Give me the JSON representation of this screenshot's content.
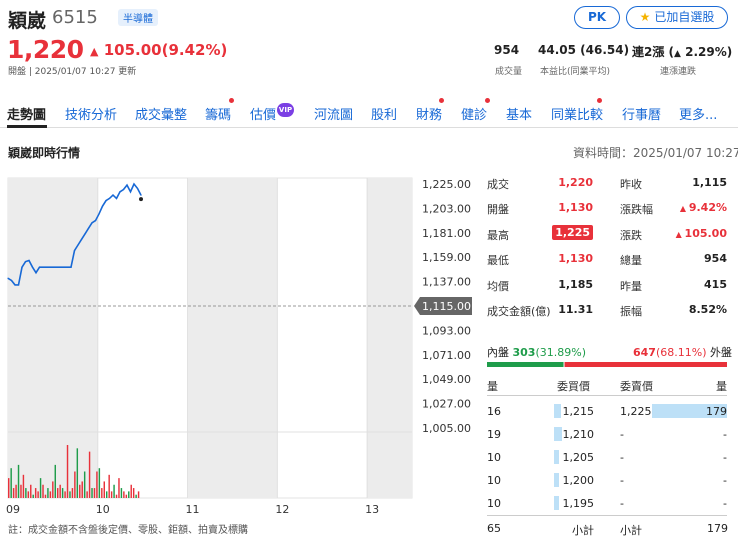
{
  "header": {
    "name": "穎崴",
    "code": "6515",
    "sector": "半導體",
    "pk_label": "PK",
    "watch_label": "已加自選股",
    "price": "1,220",
    "change": "105.00",
    "change_pct": "(9.42%)",
    "status": "開盤 | 2025/01/07 10:27 更新",
    "volume": "954",
    "volume_label": "成交量",
    "pe": "44.05 (46.54)",
    "pe_label": "本益比(同業平均)",
    "streak": "連2漲",
    "streak_pct": "2.29%",
    "streak_label": "連漲連跌"
  },
  "nav": {
    "tabs": [
      "走勢圖",
      "技術分析",
      "成交彙整",
      "籌碼",
      "估價",
      "河流圖",
      "股利",
      "財務",
      "健診",
      "基本",
      "同業比較",
      "行事曆",
      "更多..."
    ],
    "vip": "VIP"
  },
  "section": {
    "title": "穎崴即時行情",
    "data_time": "資料時間：2025/01/07 10:27"
  },
  "chart_data": {
    "type": "line",
    "x_ticks": [
      "09",
      "10",
      "11",
      "12",
      "13"
    ],
    "y_ticks": [
      "1,225.00",
      "1,203.00",
      "1,181.00",
      "1,159.00",
      "1,137.00",
      "1,115.00",
      "1,093.00",
      "1,071.00",
      "1,049.00",
      "1,027.00",
      "1,005.00"
    ],
    "ylim": [
      1005,
      1225
    ],
    "reference": 1115,
    "reference_label": "1,115.00",
    "price_series": [
      [
        0,
        1140
      ],
      [
        1,
        1138
      ],
      [
        2,
        1134
      ],
      [
        3,
        1134
      ],
      [
        4,
        1150
      ],
      [
        5,
        1155
      ],
      [
        6,
        1156
      ],
      [
        7,
        1150
      ],
      [
        8,
        1145
      ],
      [
        9,
        1150
      ],
      [
        10,
        1150
      ],
      [
        11,
        1150
      ],
      [
        12,
        1150
      ],
      [
        13,
        1150
      ],
      [
        14,
        1150
      ],
      [
        15,
        1150
      ],
      [
        16,
        1150
      ],
      [
        17,
        1150
      ],
      [
        18,
        1150
      ],
      [
        19,
        1165
      ],
      [
        20,
        1170
      ],
      [
        21,
        1175
      ],
      [
        22,
        1180
      ],
      [
        23,
        1185
      ],
      [
        24,
        1190
      ],
      [
        25,
        1192
      ],
      [
        26,
        1198
      ],
      [
        27,
        1205
      ],
      [
        28,
        1210
      ],
      [
        29,
        1212
      ],
      [
        30,
        1215
      ],
      [
        31,
        1212
      ],
      [
        32,
        1218
      ],
      [
        33,
        1220
      ],
      [
        34,
        1224
      ],
      [
        35,
        1218
      ],
      [
        36,
        1225
      ],
      [
        37,
        1221
      ],
      [
        38,
        1215
      ]
    ],
    "volume_series": [
      6,
      9,
      3,
      4,
      10,
      4,
      7,
      3,
      2,
      4,
      1,
      3,
      2,
      6,
      4,
      1,
      3,
      2,
      5,
      10,
      3,
      4,
      3,
      2,
      16,
      2,
      3,
      8,
      15,
      4,
      5,
      8,
      2,
      14,
      3,
      3,
      8,
      9,
      3,
      5,
      2,
      7,
      2,
      4,
      1,
      6,
      3,
      2,
      1,
      2,
      4,
      3,
      1,
      2
    ]
  },
  "quote": {
    "left": [
      {
        "label": "成交",
        "value": "1,220",
        "color": "red"
      },
      {
        "label": "開盤",
        "value": "1,130",
        "color": "red"
      },
      {
        "label": "最高",
        "value": "1,225",
        "color": "badge"
      },
      {
        "label": "最低",
        "value": "1,130",
        "color": "red"
      },
      {
        "label": "均價",
        "value": "1,185",
        "color": "dark"
      },
      {
        "label": "成交金額(億)",
        "value": "11.31",
        "color": "dark"
      }
    ],
    "right": [
      {
        "label": "昨收",
        "value": "1,115",
        "color": "dark"
      },
      {
        "label": "漲跌幅",
        "value": "9.42%",
        "color": "red",
        "arrow": true
      },
      {
        "label": "漲跌",
        "value": "105.00",
        "color": "red",
        "arrow": true
      },
      {
        "label": "總量",
        "value": "954",
        "color": "dark"
      },
      {
        "label": "昨量",
        "value": "415",
        "color": "dark"
      },
      {
        "label": "振幅",
        "value": "8.52%",
        "color": "dark"
      }
    ]
  },
  "inout": {
    "in_label": "內盤",
    "in_value": "303",
    "in_pct": "(31.89%)",
    "out_value": "647",
    "out_pct": "(68.11%)",
    "out_label": "外盤",
    "in_fraction": 0.3189
  },
  "orderbook": {
    "headers": [
      "量",
      "委買價",
      "委賣價",
      "量"
    ],
    "rows": [
      {
        "bid_qty": "16",
        "bid_price": "1,215",
        "ask_price": "1,225",
        "ask_qty": "179"
      },
      {
        "bid_qty": "19",
        "bid_price": "1,210",
        "ask_price": "-",
        "ask_qty": "-"
      },
      {
        "bid_qty": "10",
        "bid_price": "1,205",
        "ask_price": "-",
        "ask_qty": "-"
      },
      {
        "bid_qty": "10",
        "bid_price": "1,200",
        "ask_price": "-",
        "ask_qty": "-"
      },
      {
        "bid_qty": "10",
        "bid_price": "1,195",
        "ask_price": "-",
        "ask_qty": "-"
      }
    ],
    "bid_total": "65",
    "subtotal_label": "小計",
    "ask_total": "179"
  },
  "footnote": "註：成交金額不含盤後定價、零股、鉅額、拍賣及標購",
  "colors": {
    "up": "#e8313a",
    "down": "#1e9c4a",
    "accent": "#1869d6",
    "line": "#1869d6"
  }
}
